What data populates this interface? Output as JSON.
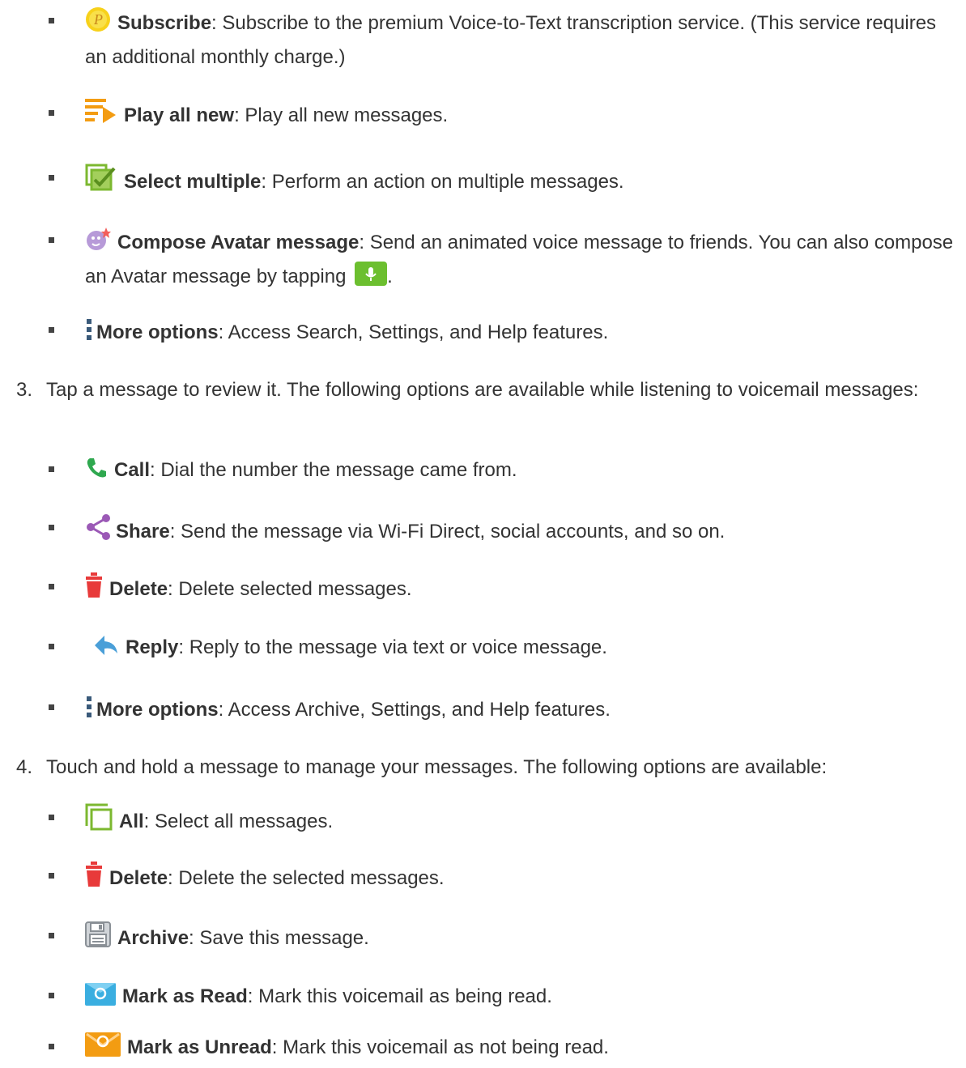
{
  "menu1": {
    "items": [
      {
        "icon": "subscribe-icon",
        "label": "Subscribe",
        "text": ": Subscribe to the premium Voice-to-Text transcription service. (This service requires an additional monthly charge.)"
      },
      {
        "icon": "play-all-new-icon",
        "label": "Play all new",
        "text": ": Play all new messages."
      },
      {
        "icon": "select-multiple-icon",
        "label": "Select multiple",
        "text": ": Perform an action on multiple messages."
      },
      {
        "icon": "avatar-icon",
        "label": "Compose Avatar message",
        "text": ": Send an animated voice message to friends. You can also compose an Avatar message by tapping",
        "trailing": "."
      },
      {
        "icon": "more-options-icon",
        "label": "More options",
        "text": ": Access Search, Settings, and Help features."
      }
    ]
  },
  "step3": {
    "number": "3.",
    "text": "Tap a message to review it. The following options are available while listening to voicemail messages:",
    "items": [
      {
        "icon": "phone-icon",
        "label": "Call",
        "text": ": Dial the number the message came from."
      },
      {
        "icon": "share-icon",
        "label": "Share",
        "text": ": Send the message via Wi-Fi Direct, social accounts, and so on."
      },
      {
        "icon": "trash-icon",
        "label": "Delete",
        "text": ": Delete selected messages."
      },
      {
        "icon": "reply-icon",
        "label": "Reply",
        "text": ": Reply to the message via text or voice message."
      },
      {
        "icon": "more-options-icon",
        "label": "More options",
        "text": ": Access Archive, Settings, and Help features."
      }
    ]
  },
  "step4": {
    "number": "4.",
    "text": "Touch and hold a message to manage your messages. The following options are available:",
    "items": [
      {
        "icon": "select-all-icon",
        "label": "All",
        "text": ": Select all messages."
      },
      {
        "icon": "trash-icon",
        "label": "Delete",
        "text": ": Delete the selected messages."
      },
      {
        "icon": "archive-icon",
        "label": "Archive",
        "text": ": Save this message."
      },
      {
        "icon": "mark-read-icon",
        "label": "Mark as Read",
        "text": ": Mark this voicemail as being read."
      },
      {
        "icon": "mark-unread-icon",
        "label": "Mark as Unread",
        "text": ": Mark this voicemail as not being read."
      }
    ]
  },
  "colors": {
    "text": "#333333",
    "accent_green": "#7cb830",
    "accent_orange": "#f39c12",
    "delete_red": "#e83a3a",
    "reply_blue": "#4a9fd8",
    "share_purple": "#9b59b6"
  }
}
